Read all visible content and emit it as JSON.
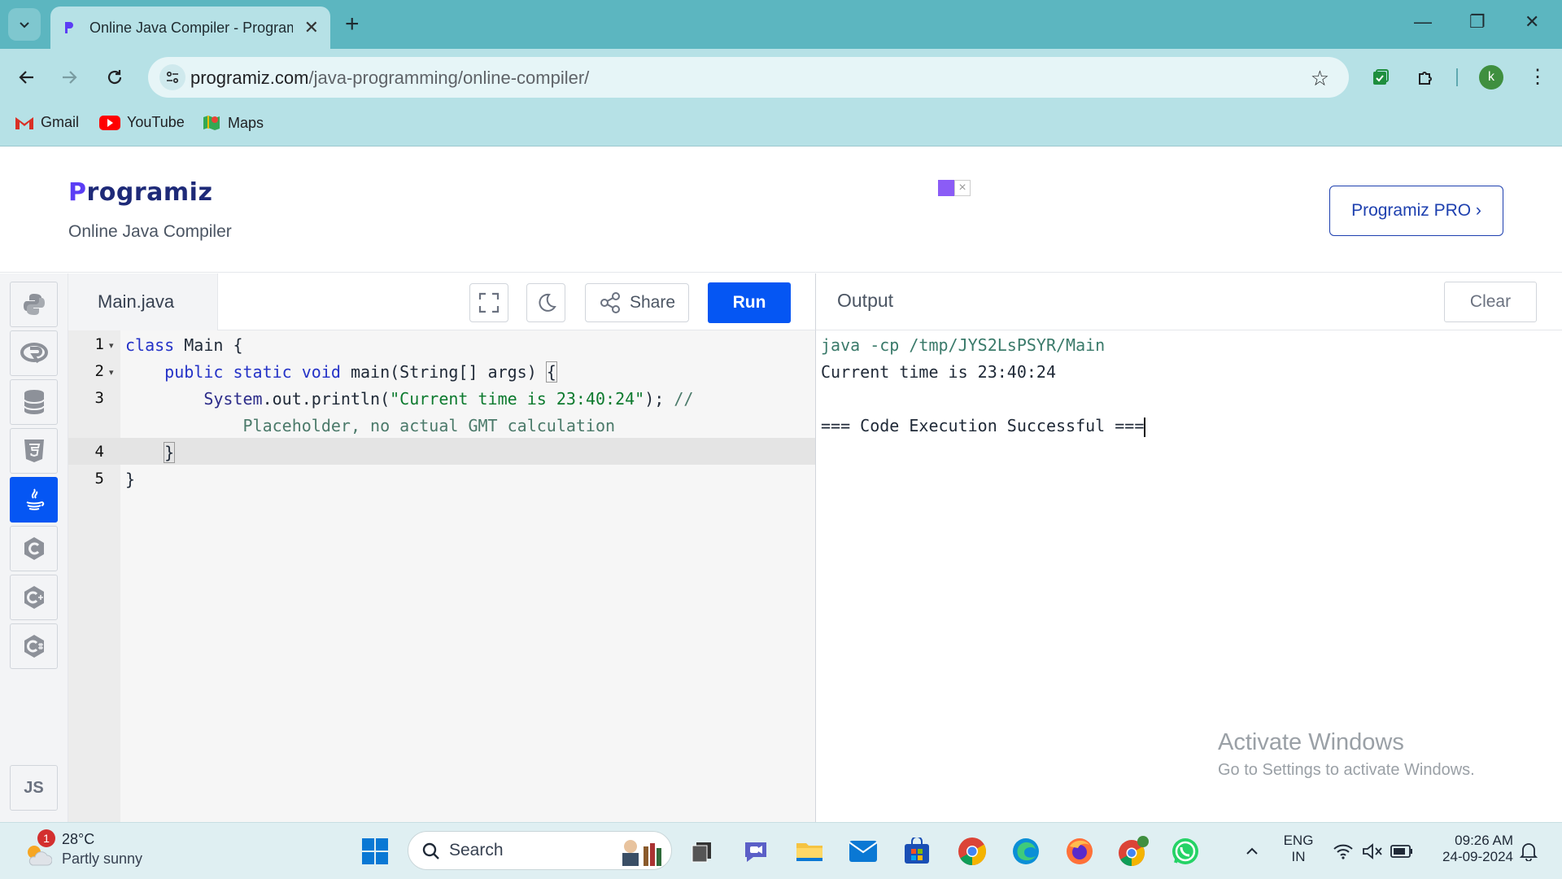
{
  "browser": {
    "tab_title": "Online Java Compiler - Programiz",
    "url_host": "programiz.com",
    "url_path": "/java-programming/online-compiler/",
    "profile_initial": "k",
    "bookmarks": [
      {
        "label": "Gmail"
      },
      {
        "label": "YouTube"
      },
      {
        "label": "Maps"
      }
    ]
  },
  "page": {
    "logo": "rogramiz",
    "logo_p": "P",
    "subtitle": "Online Java Compiler",
    "pro_button": "Programiz PRO ›",
    "sidebar_js": "JS",
    "file_tab": "Main.java",
    "share_label": "Share",
    "run_label": "Run",
    "output_title": "Output",
    "clear_label": "Clear"
  },
  "code": {
    "line_numbers": [
      "1",
      "2",
      "3",
      "",
      "4",
      "5"
    ],
    "l1_kw": "class",
    "l1_rest": " Main {",
    "l2_kw": "public static void",
    "l2_rest": " main(String[] args) ",
    "l2_brace": "{",
    "l3_obj": "System",
    "l3_call": ".out.println(",
    "l3_str": "\"Current time is 23:40:24\"",
    "l3_end": "); ",
    "l3_comment": "//",
    "l3b_comment": "Placeholder, no actual GMT calculation",
    "l4": "}",
    "l5": "}"
  },
  "output": {
    "cmd": "java -cp /tmp/JYS2LsPSYR/Main",
    "line1": "Current time is 23:40:24",
    "line2": "=== Code Execution Successful ==="
  },
  "watermark": {
    "title": "Activate Windows",
    "subtitle": "Go to Settings to activate Windows."
  },
  "taskbar": {
    "badge": "1",
    "temperature": "28°C",
    "condition": "Partly sunny",
    "search_placeholder": "Search",
    "lang_top": "ENG",
    "lang_bottom": "IN",
    "time": "09:26 AM",
    "date": "24-09-2024"
  },
  "colors": {
    "run": "#0556f3",
    "tabbar": "#5cb6c0",
    "toolbar": "#b6e1e6"
  }
}
